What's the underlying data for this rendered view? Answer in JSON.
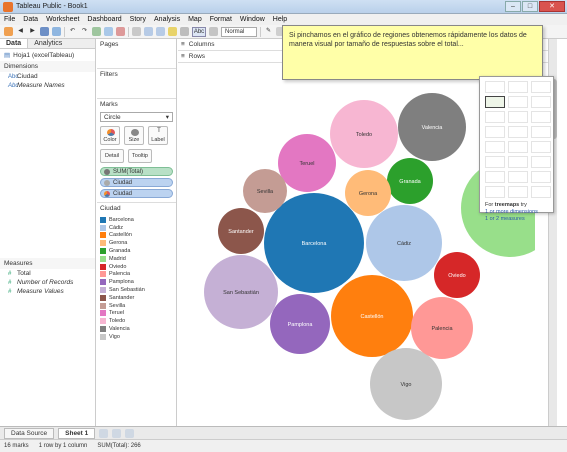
{
  "window": {
    "title": "Tableau Public - Book1"
  },
  "menu": [
    "File",
    "Data",
    "Worksheet",
    "Dashboard",
    "Story",
    "Analysis",
    "Map",
    "Format",
    "Window",
    "Help"
  ],
  "toolbar": {
    "abc_label": "Abc",
    "fit_select": "Normal"
  },
  "datapane": {
    "tabs": [
      "Data",
      "Analytics"
    ],
    "datasource": "Hoja1 (excelTableau)",
    "dimensions_label": "Dimensions",
    "dimensions": [
      "Ciudad",
      "Measure Names"
    ],
    "measures_label": "Measures",
    "measures": [
      "Total",
      "Number of Records",
      "Measure Values"
    ]
  },
  "shelves": {
    "pages": "Pages",
    "filters": "Filters",
    "marks": "Marks",
    "mark_type": "Circle",
    "color": "Color",
    "size": "Size",
    "label": "Label",
    "detail": "Detail",
    "tooltip": "Tooltip",
    "pill_size": "SUM(Total)",
    "pill_label": "Ciudad",
    "pill_color": "Ciudad",
    "legend_title": "Ciudad",
    "columns": "Columns",
    "rows": "Rows"
  },
  "legend": [
    {
      "name": "Barcelona",
      "color": "#1f77b4"
    },
    {
      "name": "Cádiz",
      "color": "#aec7e8"
    },
    {
      "name": "Castellón",
      "color": "#ff7f0e"
    },
    {
      "name": "Gerona",
      "color": "#ffbb78"
    },
    {
      "name": "Granada",
      "color": "#2ca02c"
    },
    {
      "name": "Madrid",
      "color": "#98df8a"
    },
    {
      "name": "Oviedo",
      "color": "#d62728"
    },
    {
      "name": "Palencia",
      "color": "#ff9896"
    },
    {
      "name": "Pamplona",
      "color": "#9467bd"
    },
    {
      "name": "San Sebastián",
      "color": "#c5b0d5"
    },
    {
      "name": "Santander",
      "color": "#8c564b"
    },
    {
      "name": "Sevilla",
      "color": "#c49c94"
    },
    {
      "name": "Teruel",
      "color": "#e377c2"
    },
    {
      "name": "Toledo",
      "color": "#f7b6d2"
    },
    {
      "name": "Valencia",
      "color": "#7f7f7f"
    },
    {
      "name": "Vigo",
      "color": "#c7c7c7"
    }
  ],
  "tooltip_note": "Si pinchamos en el gráfico de regiones obtenemos rápidamente los datos de manera visual por tamaño de respuestas sobre el total...",
  "showme": {
    "hint_prefix": "For",
    "hint_chart": "treemaps",
    "hint_try": "try",
    "hint_line1": "1 or more dimensions",
    "hint_line2": "1 or 2 measures"
  },
  "bottom_tabs": {
    "data_source": "Data Source",
    "sheet": "Sheet 1"
  },
  "status": {
    "marks": "16 marks",
    "rows_cols": "1 row by 1 column",
    "sum": "SUM(Total): 266"
  },
  "chart_data": {
    "type": "packed-bubble",
    "size_measure": "SUM(Total)",
    "bubbles": [
      {
        "name": "Barcelona",
        "color": "#1f77b4"
      },
      {
        "name": "Madrid",
        "color": "#98df8a"
      },
      {
        "name": "Castellón",
        "color": "#ff7f0e"
      },
      {
        "name": "Cádiz",
        "color": "#aec7e8"
      },
      {
        "name": "San Sebastián",
        "color": "#c5b0d5"
      },
      {
        "name": "Toledo",
        "color": "#f7b6d2"
      },
      {
        "name": "Valencia",
        "color": "#7f7f7f"
      },
      {
        "name": "Vigo",
        "color": "#c7c7c7"
      },
      {
        "name": "Palencia",
        "color": "#ff9896"
      },
      {
        "name": "Teruel",
        "color": "#e377c2"
      },
      {
        "name": "Pamplona",
        "color": "#9467bd"
      },
      {
        "name": "Oviedo",
        "color": "#d62728"
      },
      {
        "name": "Granada",
        "color": "#2ca02c"
      },
      {
        "name": "Gerona",
        "color": "#ffbb78"
      },
      {
        "name": "Santander",
        "color": "#8c564b"
      },
      {
        "name": "Sevilla",
        "color": "#c49c94"
      }
    ]
  }
}
